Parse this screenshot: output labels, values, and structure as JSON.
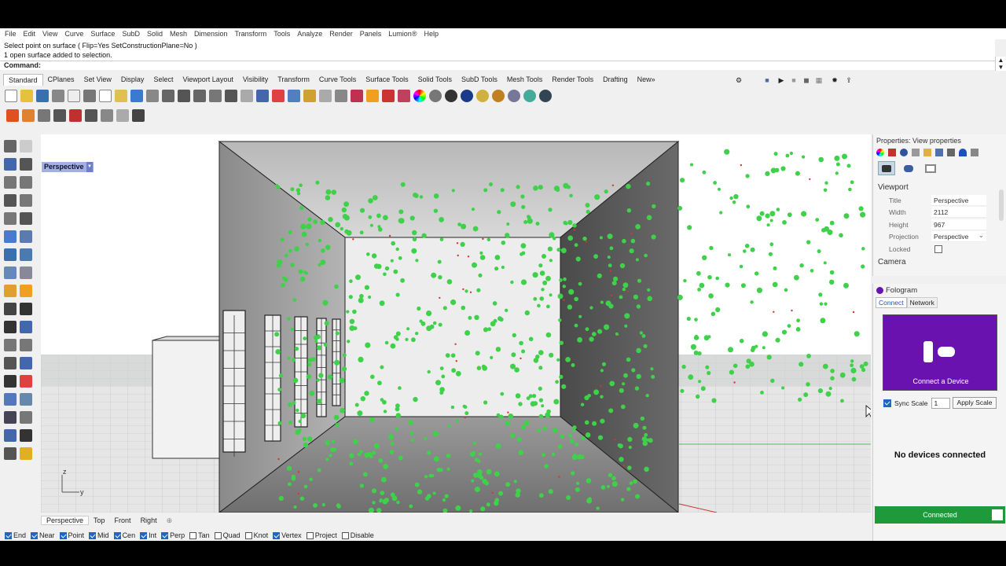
{
  "menu": [
    "File",
    "Edit",
    "View",
    "Curve",
    "Surface",
    "SubD",
    "Solid",
    "Mesh",
    "Dimension",
    "Transform",
    "Tools",
    "Analyze",
    "Render",
    "Panels",
    "Lumion®",
    "Help"
  ],
  "command": {
    "history_line1": "Select point on surface ( Flip=Yes  SetConstructionPlane=No )",
    "history_line2": "1 open surface added to selection.",
    "prompt": "Command:"
  },
  "toolbar_tabs": [
    "Standard",
    "CPlanes",
    "Set View",
    "Display",
    "Select",
    "Viewport Layout",
    "Visibility",
    "Transform",
    "Curve Tools",
    "Surface Tools",
    "Solid Tools",
    "SubD Tools",
    "Mesh Tools",
    "Render Tools",
    "Drafting",
    "New»"
  ],
  "viewport": {
    "title": "Perspective",
    "menu_icon": "chevron-down-icon",
    "axis_z": "z",
    "axis_y": "y",
    "tabs": [
      "Perspective",
      "Top",
      "Front",
      "Right"
    ],
    "add_icon": "plus-icon"
  },
  "osnaps": [
    {
      "label": "End",
      "checked": true
    },
    {
      "label": "Near",
      "checked": true
    },
    {
      "label": "Point",
      "checked": true
    },
    {
      "label": "Mid",
      "checked": true
    },
    {
      "label": "Cen",
      "checked": true
    },
    {
      "label": "Int",
      "checked": true
    },
    {
      "label": "Perp",
      "checked": true
    },
    {
      "label": "Tan",
      "checked": false
    },
    {
      "label": "Quad",
      "checked": false
    },
    {
      "label": "Knot",
      "checked": false
    },
    {
      "label": "Vertex",
      "checked": true
    },
    {
      "label": "Project",
      "checked": false
    },
    {
      "label": "Disable",
      "checked": false
    }
  ],
  "properties": {
    "title": "Properties: View properties",
    "section": "Viewport",
    "rows": [
      {
        "key": "Title",
        "value": "Perspective"
      },
      {
        "key": "Width",
        "value": "2112"
      },
      {
        "key": "Height",
        "value": "967"
      },
      {
        "key": "Projection",
        "value": "Perspective"
      },
      {
        "key": "Locked",
        "value": ""
      }
    ],
    "section2": "Camera"
  },
  "fologram": {
    "title": "Fologram",
    "tabs": [
      "Connect",
      "Network"
    ],
    "card_label": "Connect a Device",
    "sync_scale_label": "Sync Scale",
    "sync_scale_checked": true,
    "scale_value": "1",
    "apply_button": "Apply Scale",
    "status": "No devices connected",
    "connection": "Connected"
  },
  "colors": {
    "accent": "#6a12b0",
    "connected": "#1f9a3a",
    "viewport_label": "#a3b0e6",
    "points": "#3fd14a"
  }
}
